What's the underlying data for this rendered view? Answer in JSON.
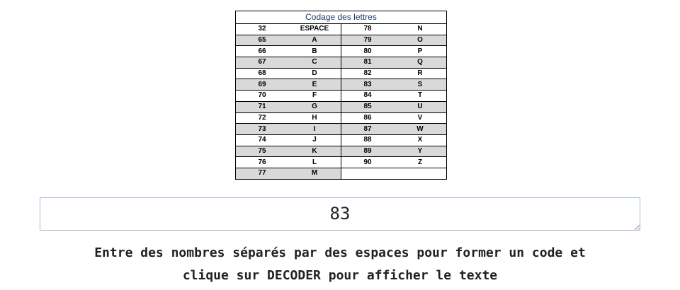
{
  "table": {
    "title": "Codage des lettres",
    "rows": [
      [
        "32",
        "ESPACE",
        "78",
        "N"
      ],
      [
        "65",
        "A",
        "79",
        "O"
      ],
      [
        "66",
        "B",
        "80",
        "P"
      ],
      [
        "67",
        "C",
        "81",
        "Q"
      ],
      [
        "68",
        "D",
        "82",
        "R"
      ],
      [
        "69",
        "E",
        "83",
        "S"
      ],
      [
        "70",
        "F",
        "84",
        "T"
      ],
      [
        "71",
        "G",
        "85",
        "U"
      ],
      [
        "72",
        "H",
        "86",
        "V"
      ],
      [
        "73",
        "I",
        "87",
        "W"
      ],
      [
        "74",
        "J",
        "88",
        "X"
      ],
      [
        "75",
        "K",
        "89",
        "Y"
      ],
      [
        "76",
        "L",
        "90",
        "Z"
      ],
      [
        "77",
        "M",
        "",
        ""
      ]
    ]
  },
  "code_input": {
    "value": "83"
  },
  "instructions": {
    "line1": "Entre des nombres séparés par des espaces pour former un code et",
    "line2": "clique sur DECODER pour afficher le texte"
  },
  "colors": {
    "row_alt": "#d9d9d9",
    "title_text": "#1f3a64",
    "input_border": "#9fb8d6"
  }
}
